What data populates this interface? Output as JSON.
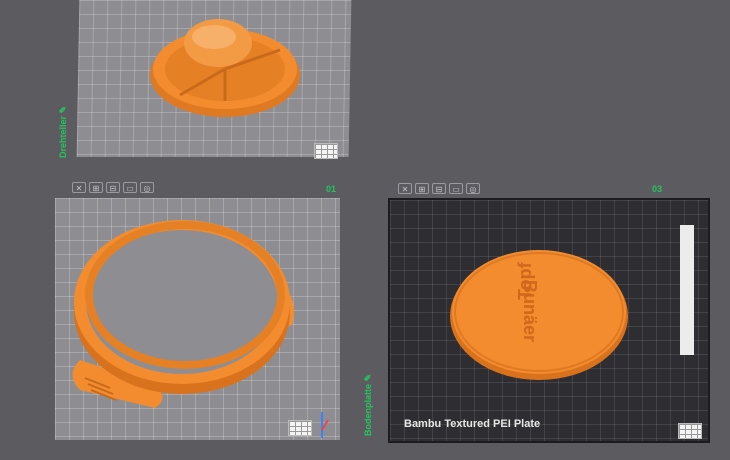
{
  "plates": [
    {
      "name": "Drehteller",
      "icon": "✎",
      "number": ""
    },
    {
      "name": "",
      "icon": "",
      "number": "01"
    },
    {
      "name": "Bodenplatte",
      "icon": "✎",
      "number": "03",
      "build_plate_type": "Bambu Textured PEI Plate",
      "part_text_lines": [
        "Bunäer",
        "Topf"
      ]
    }
  ],
  "plate_toolbar": [
    "remove-plate-icon",
    "arrange-icon",
    "orient-icon",
    "lock-icon",
    "settings-icon"
  ],
  "plate_toolbar_glyphs": [
    "✕",
    "⊞",
    "⊟",
    "▭",
    "◎"
  ],
  "colors": {
    "filament": "#f0892d",
    "label_green": "#22c55e"
  }
}
